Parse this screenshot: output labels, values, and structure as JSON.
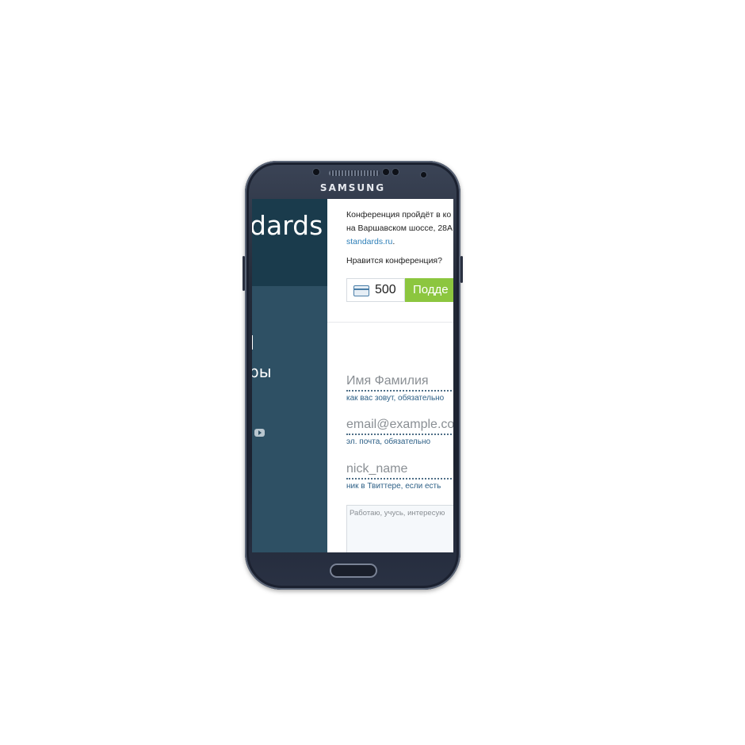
{
  "device": {
    "brand": "SAMSUNG"
  },
  "sidebar": {
    "logo_text": "dards",
    "nav_item_text": "ры"
  },
  "content": {
    "info_line1": "Конференция пройдёт в ко",
    "info_line2": "на Варшавском шоссе, 28А",
    "info_link": "standards.ru",
    "info_after_link": ".",
    "like_question": "Нравится конференция?",
    "donate_amount": "500",
    "support_button": "Подде"
  },
  "form": {
    "name": {
      "value": "Имя Фамилия",
      "hint": "как вас зовут, обязательно"
    },
    "email": {
      "value": "email@example.co",
      "hint": "эл. почта, обязательно"
    },
    "twitter": {
      "value": "nick_name",
      "hint": "ник в Твиттере, если есть"
    },
    "about": {
      "placeholder": "Работаю, учусь, интересую"
    }
  },
  "colors": {
    "sidebar_dark": "#1a3b4c",
    "sidebar": "#2e5064",
    "accent_green": "#8cc63f",
    "link": "#2d7fb8"
  }
}
